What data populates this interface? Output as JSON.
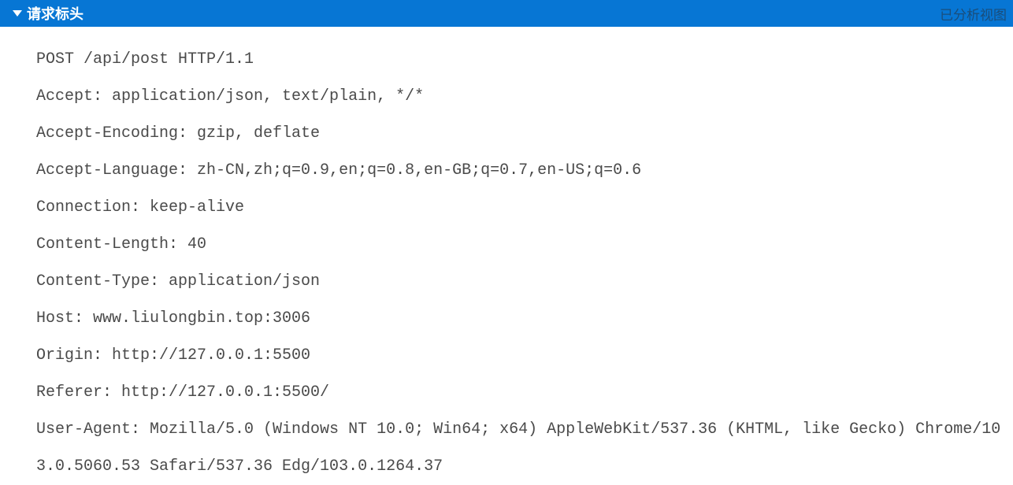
{
  "header": {
    "title": "请求标头",
    "viewLabel": "已分析视图"
  },
  "request": {
    "line": "POST /api/post HTTP/1.1",
    "headers": [
      "Accept: application/json, text/plain, */*",
      "Accept-Encoding: gzip, deflate",
      "Accept-Language: zh-CN,zh;q=0.9,en;q=0.8,en-GB;q=0.7,en-US;q=0.6",
      "Connection: keep-alive",
      "Content-Length: 40",
      "Content-Type: application/json",
      "Host: www.liulongbin.top:3006",
      "Origin: http://127.0.0.1:5500",
      "Referer: http://127.0.0.1:5500/",
      "User-Agent: Mozilla/5.0 (Windows NT 10.0; Win64; x64) AppleWebKit/537.36 (KHTML, like Gecko) Chrome/103.0.5060.53 Safari/537.36 Edg/103.0.1264.37"
    ]
  }
}
